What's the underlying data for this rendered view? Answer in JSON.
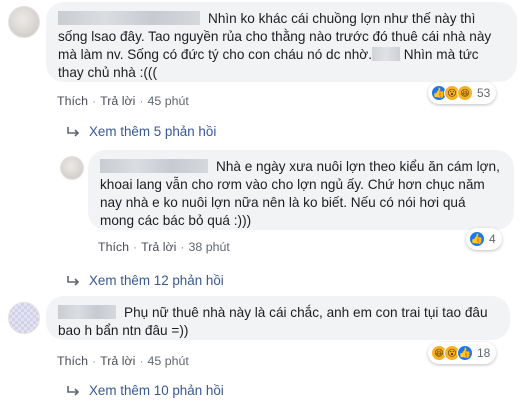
{
  "comments": [
    {
      "text": "Nhìn ko khác cái chuồng lợn như thế này thì sống lsao đây. Tao nguyền rủa cho thằng nào trước đó thuê cái nhà này mà làm nv. Sống có đức tý cho con cháu nó dc nhờ.",
      "text_after": " Nhìn mà tức thay chủ nhà :(((",
      "actions": {
        "like": "Thích",
        "reply": "Trả lời",
        "time": "45 phút"
      },
      "reactions": {
        "icons": [
          "like-icon",
          "wow-icon",
          "haha-icon"
        ],
        "count": "53"
      },
      "more_replies": "Xem thêm 5 phản hồi"
    },
    {
      "text": "Nhà e ngày xưa nuôi lợn theo kiểu ăn cám lợn, khoai lang vẫn cho rơm vào cho lợn ngủ ấy. Chứ hơn chục năm nay nhà e ko nuôi lợn nữa nên là ko biết. Nếu có nói hơi quá mong các bác bỏ quá :)))",
      "actions": {
        "like": "Thích",
        "reply": "Trả lời",
        "time": "38 phút"
      },
      "reactions": {
        "icons": [
          "like-icon"
        ],
        "count": "4"
      },
      "more_replies": "Xem thêm 12 phản hồi"
    },
    {
      "text": "Phụ nữ thuê nhà này là cái chắc, anh em con trai tụi tao đâu bao h bẩn ntn đâu =))",
      "actions": {
        "like": "Thích",
        "reply": "Trả lời",
        "time": "45 phút"
      },
      "reactions": {
        "icons": [
          "haha-icon",
          "wow-icon",
          "like-icon"
        ],
        "count": "18"
      },
      "more_replies": "Xem thêm 10 phản hồi"
    }
  ],
  "colors": {
    "link": "#385898",
    "bubble": "#f2f3f5",
    "like": "#1877f2",
    "meta": "#606770"
  }
}
